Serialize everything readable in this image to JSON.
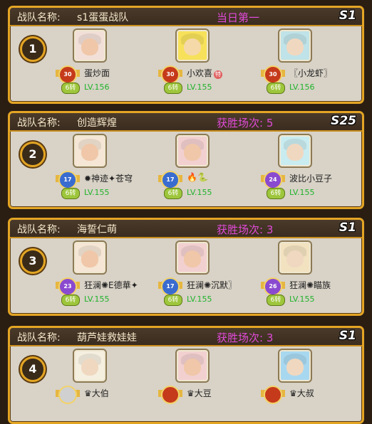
{
  "hdr_label": "战队名称:",
  "teams": [
    {
      "rank": "1",
      "name": "s1蛋蛋战队",
      "status": "当日第一",
      "season": "S1",
      "members": [
        {
          "name": "蛋炒面",
          "rebirth": "6转",
          "level": "LV.156",
          "badge": "30",
          "face": "#f0c7a8",
          "hair": "#f2e0d8",
          "badge_color": "#c53a1a"
        },
        {
          "name": "小欢喜",
          "tag": "特",
          "rebirth": "6转",
          "level": "LV.155",
          "badge": "30",
          "face": "#f5d9a8",
          "hair": "#f7e15a",
          "badge_color": "#c53a1a"
        },
        {
          "name": "〖小龙虾〗",
          "rebirth": "6转",
          "level": "LV.156",
          "badge": "30",
          "face": "#f0d8c0",
          "hair": "#bfe3e8",
          "badge_color": "#c53a1a"
        }
      ]
    },
    {
      "rank": "2",
      "name": "创造辉煌",
      "status": "获胜场次: 5",
      "season": "S25",
      "members": [
        {
          "name": "✹神迹✦苍穹",
          "rebirth": "6转",
          "level": "LV.155",
          "badge": "17",
          "face": "#f0c7a8",
          "hair": "#f5e6d5",
          "badge_color": "#3a6cd0"
        },
        {
          "name": "🔥🐍",
          "rebirth": "6转",
          "level": "LV.155",
          "badge": "17",
          "face": "#f0c7a8",
          "hair": "#f2d0d0",
          "badge_color": "#3a6cd0"
        },
        {
          "name": "波比小豆子",
          "rebirth": "6转",
          "level": "LV.155",
          "badge": "24",
          "face": "#f0d8c0",
          "hair": "#c9ecf0",
          "badge_color": "#8a4ad0"
        }
      ]
    },
    {
      "rank": "3",
      "name": "海誓仁萌",
      "status": "获胜场次: 3",
      "season": "S1",
      "members": [
        {
          "name": "狂澜✺E德華✦",
          "rebirth": "6转",
          "level": "LV.155",
          "badge": "23",
          "face": "#f0c7a8",
          "hair": "#f5e6d5",
          "badge_color": "#8a4ad0"
        },
        {
          "name": "狂澜✺沉默〗",
          "rebirth": "6转",
          "level": "LV.155",
          "badge": "17",
          "face": "#f0c7a8",
          "hair": "#f2d0d0",
          "badge_color": "#3a6cd0"
        },
        {
          "name": "狂澜✺瞄族",
          "rebirth": "6转",
          "level": "LV.155",
          "badge": "26",
          "face": "#f0d8c0",
          "hair": "#f2e2c0",
          "badge_color": "#8a4ad0"
        }
      ]
    },
    {
      "rank": "4",
      "name": "葫芦娃救娃娃",
      "status": "获胜场次: 3",
      "season": "S1",
      "members": [
        {
          "name": "♛大伯",
          "rebirth": "",
          "level": "",
          "badge": "",
          "face": "#f0d8c0",
          "hair": "#f5efe0",
          "badge_color": "#d0d0d0"
        },
        {
          "name": "♛大豆",
          "rebirth": "",
          "level": "",
          "badge": "",
          "face": "#f0c7a8",
          "hair": "#f2d0d0",
          "badge_color": "#c53a1a"
        },
        {
          "name": "♛大叔",
          "rebirth": "",
          "level": "",
          "badge": "",
          "face": "#f0d8c0",
          "hair": "#a8d8f0",
          "badge_color": "#c53a1a"
        }
      ]
    }
  ]
}
